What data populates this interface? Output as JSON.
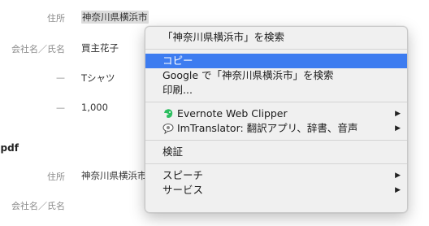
{
  "form": {
    "block1": {
      "address_label": "住所",
      "address_value": "神奈川県横浜市",
      "company_label": "会社名／氏名",
      "company_value": "買主花子",
      "item_label": "—",
      "item_value": "Tシャツ",
      "price_label": "—",
      "price_value": "1,000"
    },
    "section2_title": ".pdf",
    "block2": {
      "address_label": "住所",
      "address_value": "神奈川県横浜市",
      "company_label": "会社名／氏名"
    }
  },
  "context_menu": {
    "search_selection": "「神奈川県横浜市」を検索",
    "copy": "コピー",
    "google_search": "Google で「神奈川県横浜市」を検索",
    "print": "印刷...",
    "evernote": "Evernote Web Clipper",
    "imtranslator": "ImTranslator: 翻訳アプリ、辞書、音声",
    "inspect": "検証",
    "speech": "スピーチ",
    "services": "サービス",
    "submenu_arrow": "▶",
    "accent_color": "#3d7cf0"
  }
}
